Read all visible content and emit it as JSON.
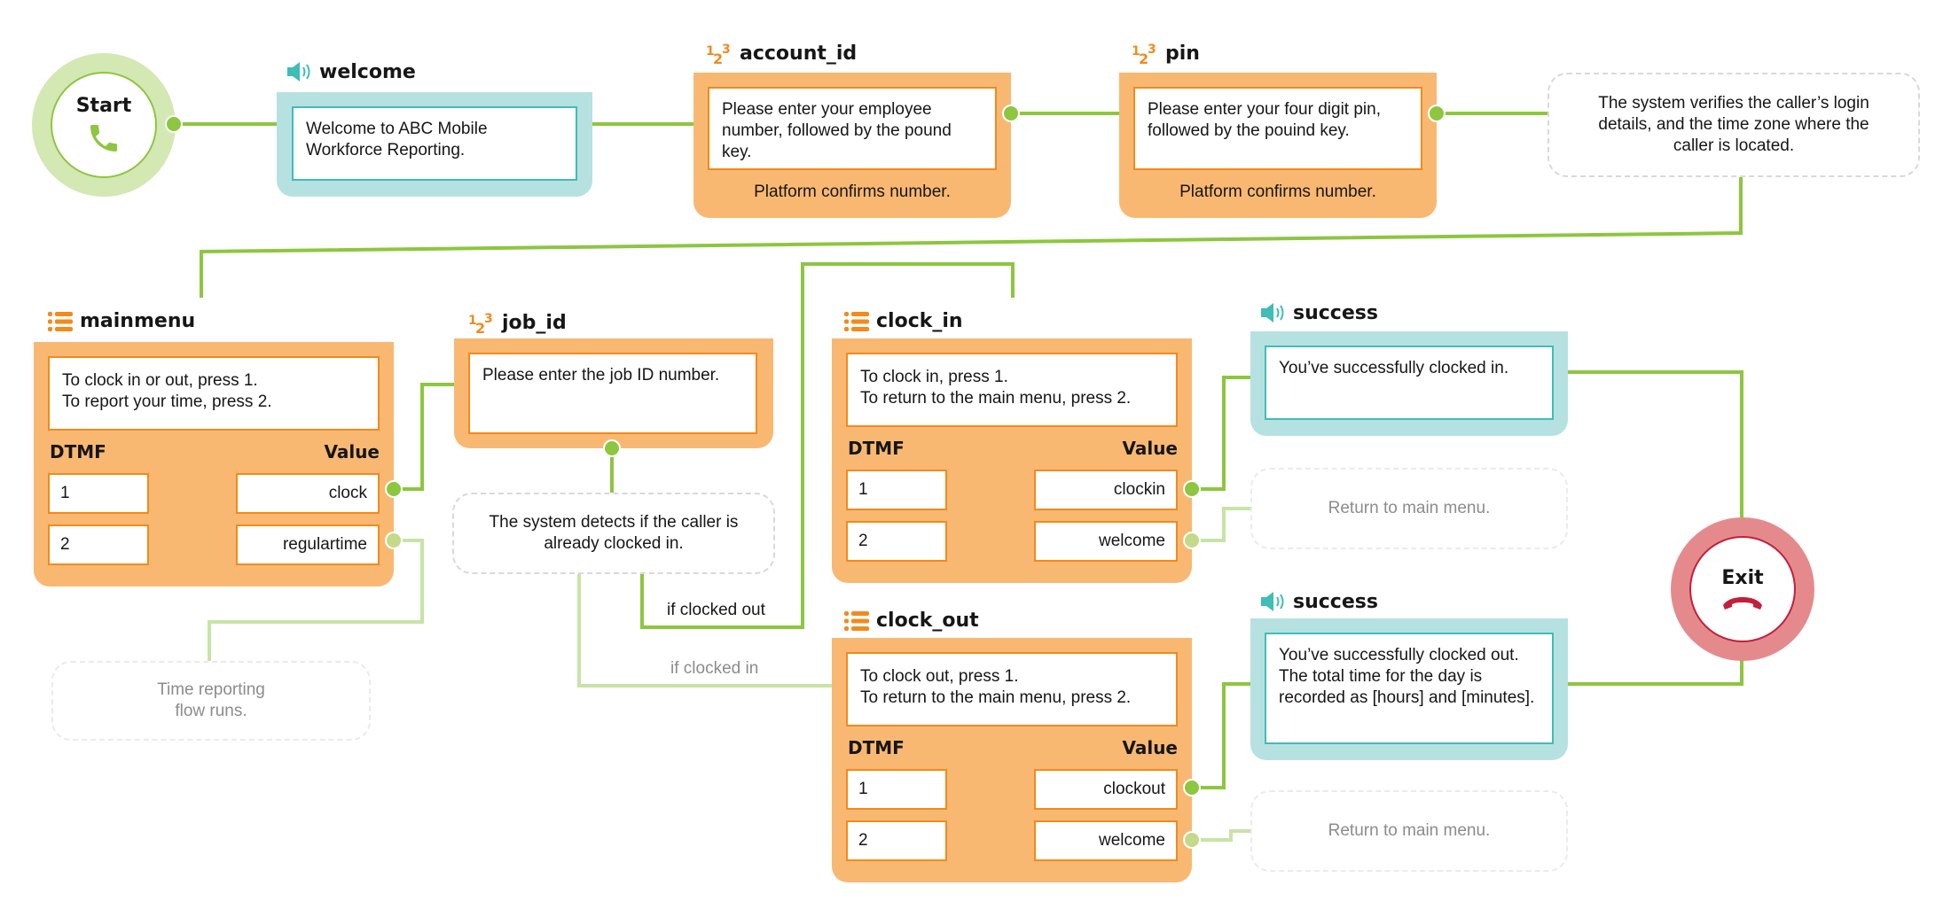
{
  "colors": {
    "connector_active": "#8dc63f",
    "connector_inactive": "#c7e4a6",
    "orange_card": "#f9b872",
    "orange_border": "#f28a1c",
    "teal_card": "#b6e1e1",
    "teal_border": "#3fbdb7",
    "start_ring": "#d3e8b3",
    "exit_ring": "#e58a8c",
    "exit_accent": "#c41e3a"
  },
  "start": {
    "label": "Start",
    "icon": "phone-icon"
  },
  "exit": {
    "label": "Exit",
    "icon": "hang-up-icon"
  },
  "welcome": {
    "title": "welcome",
    "icon": "speaker-icon",
    "prompt": "Welcome to ABC Mobile Workforce Reporting."
  },
  "account_id": {
    "title": "account_id",
    "icon": "number-input-icon",
    "prompt": "Please enter your employee number, followed by the pound key.",
    "confirm": "Platform confirms number."
  },
  "pin": {
    "title": "pin",
    "icon": "number-input-icon",
    "prompt": "Please enter your four digit pin, followed by the pouind key.",
    "confirm": "Platform confirms number."
  },
  "verify_note": "The system verifies the caller’s login details, and the time zone where the caller is located.",
  "mainmenu": {
    "title": "mainmenu",
    "icon": "menu-list-icon",
    "prompt_lines": [
      "To clock in or out, press 1.",
      "To report your time, press 2."
    ],
    "dtmf_header": "DTMF",
    "value_header": "Value",
    "rows": [
      {
        "dtmf": "1",
        "value": "clock"
      },
      {
        "dtmf": "2",
        "value": "regulartime"
      }
    ]
  },
  "time_report_note": "Time reporting flow runs.",
  "job_id": {
    "title": "job_id",
    "icon": "number-input-icon",
    "prompt": "Please enter the job ID number."
  },
  "detect_note": "The system detects if the caller is already clocked in.",
  "edge_labels": {
    "clocked_out": "if clocked out",
    "clocked_in": "if clocked in"
  },
  "clock_in": {
    "title": "clock_in",
    "icon": "menu-list-icon",
    "prompt_lines": [
      "To clock in, press 1.",
      "To return to the main menu, press 2."
    ],
    "dtmf_header": "DTMF",
    "value_header": "Value",
    "rows": [
      {
        "dtmf": "1",
        "value": "clockin"
      },
      {
        "dtmf": "2",
        "value": "welcome"
      }
    ]
  },
  "clock_out": {
    "title": "clock_out",
    "icon": "menu-list-icon",
    "prompt_lines": [
      "To clock out, press 1.",
      "To return to the main menu, press 2."
    ],
    "dtmf_header": "DTMF",
    "value_header": "Value",
    "rows": [
      {
        "dtmf": "1",
        "value": "clockout"
      },
      {
        "dtmf": "2",
        "value": "welcome"
      }
    ]
  },
  "success_in": {
    "title": "success",
    "icon": "speaker-icon",
    "prompt": "You’ve successfully clocked in."
  },
  "success_out": {
    "title": "success",
    "icon": "speaker-icon",
    "prompt": "You’ve successfully clocked out. The total time for the day is recorded as [hours] and [minutes]."
  },
  "return_note_in": "Return to main menu.",
  "return_note_out": "Return to main menu."
}
